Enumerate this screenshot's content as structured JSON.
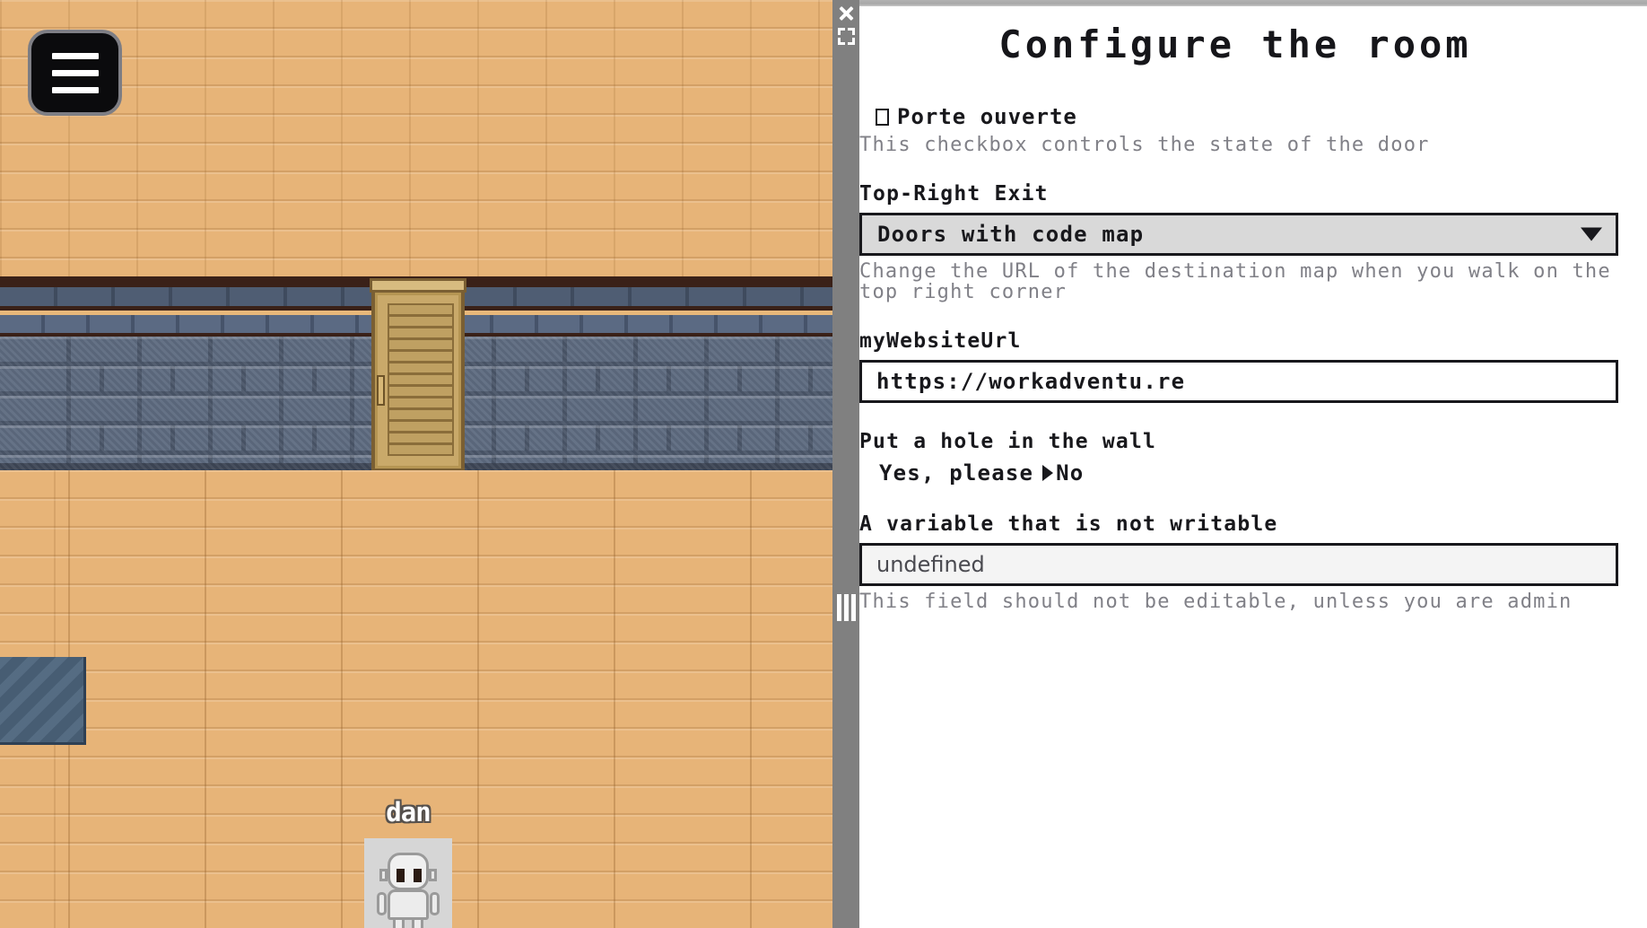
{
  "game": {
    "menu_button": {
      "icon": "hamburger-icon",
      "label": "Menu"
    },
    "player": {
      "name": "dan"
    },
    "scene": {
      "door_state": "closed",
      "floor_color": "#e7b478",
      "wall_color": "#5d6a7f",
      "door_color": "#c9a96a",
      "rug_color": "#4c647c"
    }
  },
  "divider": {
    "close_icon": "close-icon",
    "fullscreen_icon": "fullscreen-icon",
    "resize_icon": "resize-handle-icon",
    "background": "#808080"
  },
  "panel": {
    "title": "Configure the room",
    "fields": {
      "door_checkbox": {
        "label": "Porte ouverte",
        "checked": false,
        "help": "This checkbox controls the state of the door"
      },
      "top_right_exit": {
        "label": "Top-Right Exit",
        "value": "Doors with code map",
        "options": [
          "Doors with code map"
        ],
        "help": "Change the URL of the destination map when you walk on the top right corner"
      },
      "website_url": {
        "label": "myWebsiteUrl",
        "value": "https://workadventu.re",
        "placeholder": ""
      },
      "hole_in_wall": {
        "label": "Put a hole in the wall",
        "options": [
          {
            "label": "Yes, please",
            "selected": false
          },
          {
            "label": "No",
            "selected": true
          }
        ]
      },
      "not_writable": {
        "label": "A variable that is not writable",
        "value": "undefined",
        "readonly": true,
        "help": "This field should not be editable, unless you are admin"
      }
    }
  }
}
